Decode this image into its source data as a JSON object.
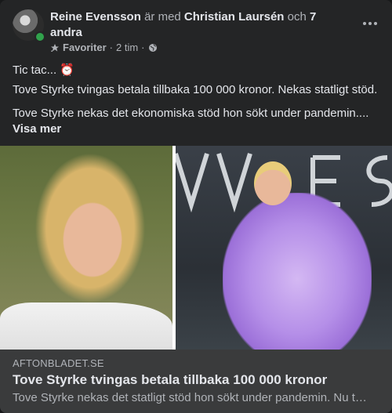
{
  "post": {
    "author": "Reine Evensson",
    "with_text": "är med",
    "tagged": "Christian Laursén",
    "and_text": "och",
    "others": "7 andra",
    "dot": ".",
    "audience": "Favoriter",
    "time": "2 tim",
    "separator": "·",
    "line1": "Tic tac... ⏰",
    "line2": "Tove Styrke tvingas betala tillbaka 100 000 kronor. Nekas statligt stöd.",
    "line3": "Tove Styrke nekas det ekonomiska stöd hon sökt under pandemin....",
    "see_more": "Visa mer"
  },
  "link": {
    "domain": "AFTONBLADET.SE",
    "title": "Tove Styrke tvingas betala tillbaka 100 000 kronor",
    "description": "Tove Styrke nekas det statligt stöd hon sökt under pandemin. Nu t…"
  },
  "icons": {
    "star": "star-icon",
    "globe": "globe-icon",
    "more": "more-options-icon",
    "alarm": "alarm-clock-emoji"
  },
  "colors": {
    "card_bg": "#242526",
    "link_bg": "#3a3b3c",
    "online": "#31a24c",
    "text_primary": "#e4e6eb",
    "text_secondary": "#b0b3b8"
  }
}
